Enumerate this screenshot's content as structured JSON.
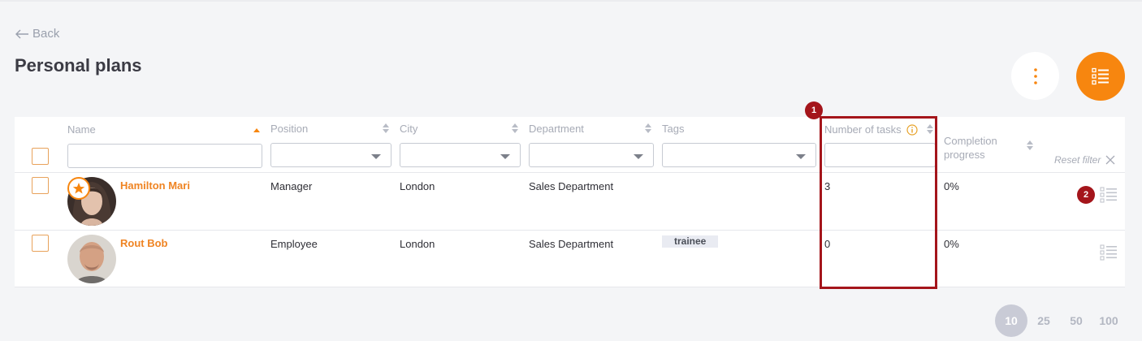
{
  "nav": {
    "back_label": "Back"
  },
  "page": {
    "title": "Personal plans"
  },
  "columns": {
    "name": "Name",
    "position": "Position",
    "city": "City",
    "department": "Department",
    "tags": "Tags",
    "tasks": "Number of tasks",
    "completion_line1": "Completion",
    "completion_line2": "progress"
  },
  "filters": {
    "name_value": "",
    "position_value": "",
    "city_value": "",
    "department_value": "",
    "tags_value": "",
    "tasks_value": "",
    "reset_label": "Reset filter"
  },
  "rows": [
    {
      "name": "Hamilton Mari",
      "position": "Manager",
      "city": "London",
      "department": "Sales Department",
      "tags": [],
      "tasks": "3",
      "completion": "0%",
      "starred": true
    },
    {
      "name": "Rout Bob",
      "position": "Employee",
      "city": "London",
      "department": "Sales Department",
      "tags": [
        "trainee"
      ],
      "tasks": "0",
      "completion": "0%",
      "starred": false
    }
  ],
  "annotations": {
    "marker_1": "1",
    "marker_2": "2"
  },
  "pagination": {
    "sizes": [
      "10",
      "25",
      "50",
      "100"
    ],
    "active": "10"
  },
  "colors": {
    "accent": "#f7860f",
    "annotation": "#a4151b",
    "muted": "#a7abb6"
  },
  "icons": [
    "arrow-left-icon",
    "more-vertical-icon",
    "plan-list-icon",
    "sort-icon",
    "info-icon",
    "close-icon",
    "star-icon",
    "checklist-icon"
  ]
}
